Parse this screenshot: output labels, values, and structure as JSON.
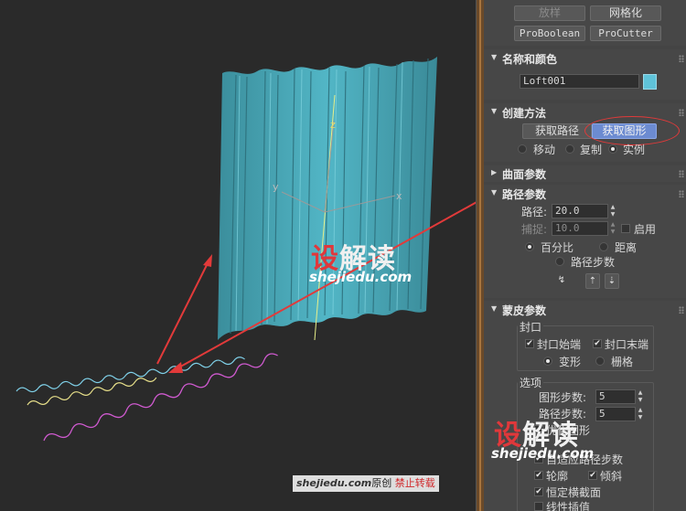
{
  "viewport": {
    "axis_labels": {
      "x": "x",
      "y": "y",
      "z": "z"
    },
    "watermark": {
      "part1": "设",
      "part2": "解读",
      "sub": "shejiedu.com"
    },
    "credit": {
      "site": "shejiedu.com",
      "mid": "原创",
      "warn": "禁止转载"
    }
  },
  "panel": {
    "top_buttons": {
      "scatter": "放样",
      "mesh": "网格化",
      "proboolean": "ProBoolean",
      "procutter": "ProCutter"
    },
    "name_color": {
      "title": "名称和颜色",
      "name_value": "Loft001",
      "color": "#5fc3d9"
    },
    "creation": {
      "title": "创建方法",
      "get_path": "获取路径",
      "get_shape": "获取图形",
      "move": "移动",
      "copy": "复制",
      "instance": "实例",
      "selected_mode": "实例"
    },
    "surface": {
      "title": "曲面参数"
    },
    "path": {
      "title": "路径参数",
      "path_label": "路径:",
      "path_value": "20.0",
      "snap_label": "捕捉:",
      "snap_value": "10.0",
      "enable": "启用",
      "percent": "百分比",
      "distance": "距离",
      "path_steps": "路径步数",
      "selected_unit": "百分比"
    },
    "skin": {
      "title": "蒙皮参数",
      "capping": {
        "title": "封口",
        "cap_start": "封口始端",
        "cap_end": "封口末端",
        "morph": "变形",
        "grid": "栅格",
        "cap_start_checked": true,
        "cap_end_checked": true,
        "selected_type": "变形"
      },
      "options": {
        "title": "选项",
        "shape_steps_label": "图形步数:",
        "shape_steps_value": "5",
        "path_steps_label": "路径步数:",
        "path_steps_value": "5",
        "optimize_shapes": "优化图形",
        "adaptive_path": "自适应路径步数",
        "contour": "轮廓",
        "banking": "倾斜",
        "constant_cross": "恒定横截面",
        "linear_interp": "线性插值"
      }
    },
    "watermark": {
      "part1": "设",
      "part2": "解读",
      "sub": "shejiedu.com"
    }
  }
}
